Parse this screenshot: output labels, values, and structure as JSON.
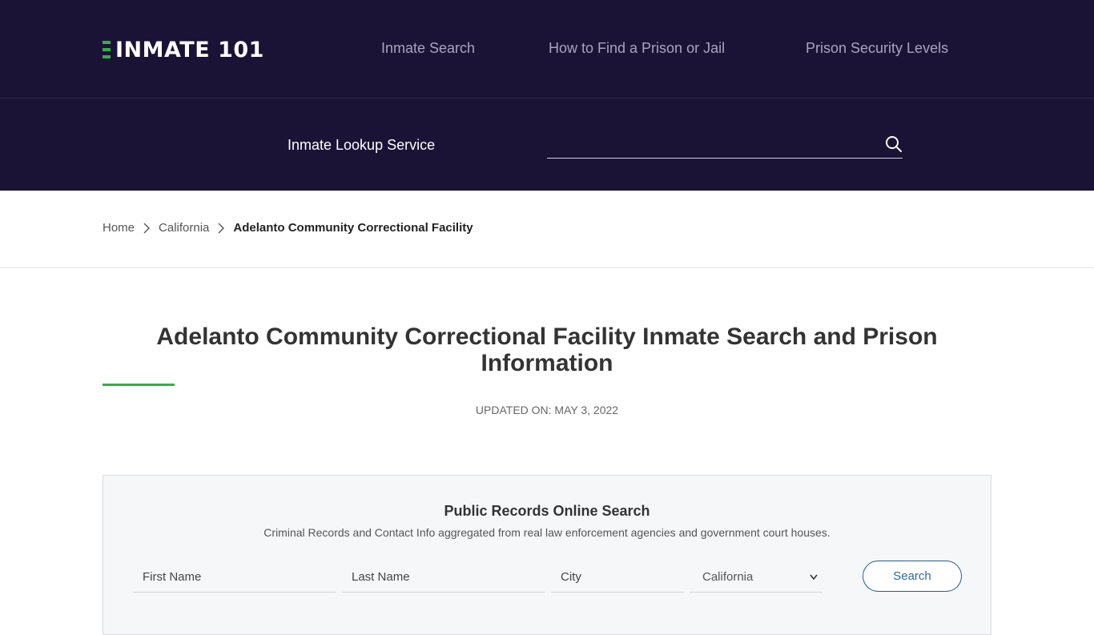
{
  "header": {
    "logo_text": "INMATE 101",
    "nav": [
      {
        "label": "Inmate Search"
      },
      {
        "label": "How to Find a Prison or Jail"
      },
      {
        "label": "Prison Security Levels"
      }
    ]
  },
  "lookup": {
    "label": "Inmate Lookup Service",
    "value": "",
    "placeholder": ""
  },
  "breadcrumb": {
    "items": [
      {
        "label": "Home"
      },
      {
        "label": "California"
      }
    ],
    "current": "Adelanto Community Correctional Facility"
  },
  "page": {
    "title": "Adelanto Community Correctional Facility Inmate Search and Prison Information",
    "updated": "UPDATED ON: MAY 3, 2022"
  },
  "records_search": {
    "title": "Public Records Online Search",
    "subtitle": "Criminal Records and Contact Info aggregated from real law enforcement agencies and government court houses.",
    "first_name_placeholder": "First Name",
    "last_name_placeholder": "Last Name",
    "city_placeholder": "City",
    "state_selected": "California",
    "button_label": "Search"
  },
  "colors": {
    "header_bg": "#1b1335",
    "accent_green": "#2fb344",
    "button_blue": "#1f5d8f"
  },
  "icons": [
    "search-icon",
    "chevron-right-icon",
    "chevron-down-icon",
    "logo-bars-icon"
  ]
}
